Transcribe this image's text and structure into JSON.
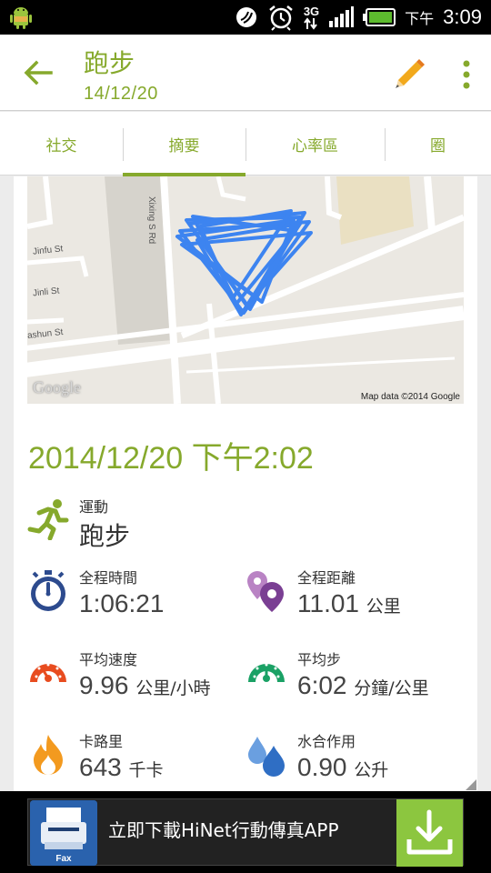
{
  "status_bar": {
    "ampm": "下午",
    "time": "3:09",
    "network": "3G",
    "icons": [
      "android-icon",
      "nfc-icon",
      "alarm-icon",
      "signal-icon",
      "battery-icon"
    ]
  },
  "action_bar": {
    "title": "跑步",
    "subtitle": "14/12/20",
    "accent_color": "#86a92c"
  },
  "tabs": [
    {
      "label": "社交",
      "selected": false
    },
    {
      "label": "摘要",
      "selected": true
    },
    {
      "label": "心率區",
      "selected": false
    },
    {
      "label": "圈",
      "selected": false
    }
  ],
  "map": {
    "street_labels": [
      "Xixing S Rd",
      "Jinfu St",
      "Jinli St",
      "ashun St"
    ],
    "google_logo": "Google",
    "credit": "Map data ©2014 Google"
  },
  "workout": {
    "datetime": "2014/12/20 下午2:02",
    "activity": {
      "label": "運動",
      "value": "跑步"
    },
    "stats": [
      {
        "label": "全程時間",
        "value": "1:06:21",
        "unit": "",
        "icon": "stopwatch-icon"
      },
      {
        "label": "全程距離",
        "value": "11.01",
        "unit": "公里",
        "icon": "location-pins-icon"
      },
      {
        "label": "平均速度",
        "value": "9.96",
        "unit": "公里/小時",
        "icon": "speed-gauge-icon"
      },
      {
        "label": "平均步",
        "value": "6:02",
        "unit": "分鐘/公里",
        "icon": "pace-gauge-icon"
      },
      {
        "label": "卡路里",
        "value": "643",
        "unit": "千卡",
        "icon": "flame-icon"
      },
      {
        "label": "水合作用",
        "value": "0.90",
        "unit": "公升",
        "icon": "water-drops-icon"
      }
    ]
  },
  "ad": {
    "text": "立即下載HiNet行動傳真APP",
    "logo_text": "Fax"
  }
}
